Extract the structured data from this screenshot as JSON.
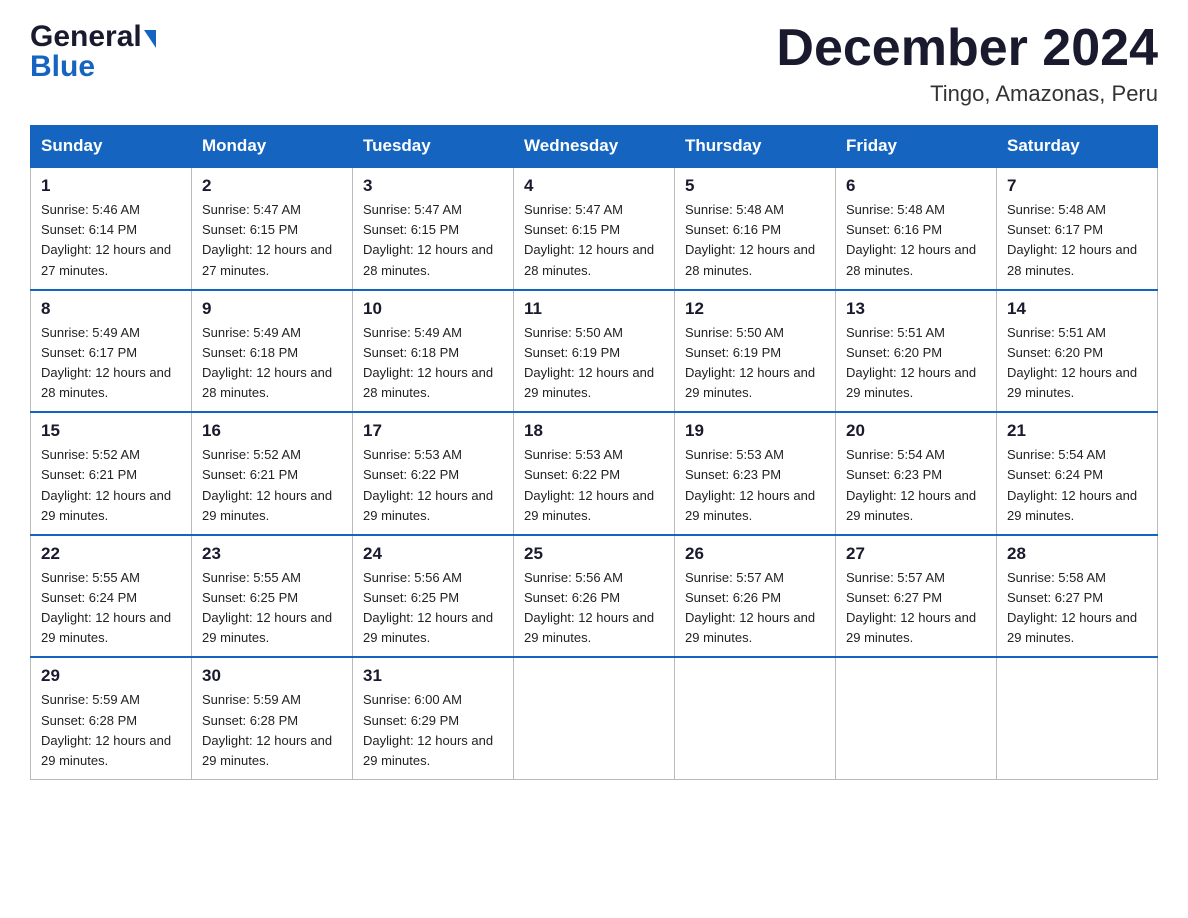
{
  "header": {
    "logo_general": "General",
    "logo_blue": "Blue",
    "month_title": "December 2024",
    "location": "Tingo, Amazonas, Peru"
  },
  "calendar": {
    "days_of_week": [
      "Sunday",
      "Monday",
      "Tuesday",
      "Wednesday",
      "Thursday",
      "Friday",
      "Saturday"
    ],
    "weeks": [
      [
        {
          "day": "1",
          "sunrise": "5:46 AM",
          "sunset": "6:14 PM",
          "daylight": "12 hours and 27 minutes."
        },
        {
          "day": "2",
          "sunrise": "5:47 AM",
          "sunset": "6:15 PM",
          "daylight": "12 hours and 27 minutes."
        },
        {
          "day": "3",
          "sunrise": "5:47 AM",
          "sunset": "6:15 PM",
          "daylight": "12 hours and 28 minutes."
        },
        {
          "day": "4",
          "sunrise": "5:47 AM",
          "sunset": "6:15 PM",
          "daylight": "12 hours and 28 minutes."
        },
        {
          "day": "5",
          "sunrise": "5:48 AM",
          "sunset": "6:16 PM",
          "daylight": "12 hours and 28 minutes."
        },
        {
          "day": "6",
          "sunrise": "5:48 AM",
          "sunset": "6:16 PM",
          "daylight": "12 hours and 28 minutes."
        },
        {
          "day": "7",
          "sunrise": "5:48 AM",
          "sunset": "6:17 PM",
          "daylight": "12 hours and 28 minutes."
        }
      ],
      [
        {
          "day": "8",
          "sunrise": "5:49 AM",
          "sunset": "6:17 PM",
          "daylight": "12 hours and 28 minutes."
        },
        {
          "day": "9",
          "sunrise": "5:49 AM",
          "sunset": "6:18 PM",
          "daylight": "12 hours and 28 minutes."
        },
        {
          "day": "10",
          "sunrise": "5:49 AM",
          "sunset": "6:18 PM",
          "daylight": "12 hours and 28 minutes."
        },
        {
          "day": "11",
          "sunrise": "5:50 AM",
          "sunset": "6:19 PM",
          "daylight": "12 hours and 29 minutes."
        },
        {
          "day": "12",
          "sunrise": "5:50 AM",
          "sunset": "6:19 PM",
          "daylight": "12 hours and 29 minutes."
        },
        {
          "day": "13",
          "sunrise": "5:51 AM",
          "sunset": "6:20 PM",
          "daylight": "12 hours and 29 minutes."
        },
        {
          "day": "14",
          "sunrise": "5:51 AM",
          "sunset": "6:20 PM",
          "daylight": "12 hours and 29 minutes."
        }
      ],
      [
        {
          "day": "15",
          "sunrise": "5:52 AM",
          "sunset": "6:21 PM",
          "daylight": "12 hours and 29 minutes."
        },
        {
          "day": "16",
          "sunrise": "5:52 AM",
          "sunset": "6:21 PM",
          "daylight": "12 hours and 29 minutes."
        },
        {
          "day": "17",
          "sunrise": "5:53 AM",
          "sunset": "6:22 PM",
          "daylight": "12 hours and 29 minutes."
        },
        {
          "day": "18",
          "sunrise": "5:53 AM",
          "sunset": "6:22 PM",
          "daylight": "12 hours and 29 minutes."
        },
        {
          "day": "19",
          "sunrise": "5:53 AM",
          "sunset": "6:23 PM",
          "daylight": "12 hours and 29 minutes."
        },
        {
          "day": "20",
          "sunrise": "5:54 AM",
          "sunset": "6:23 PM",
          "daylight": "12 hours and 29 minutes."
        },
        {
          "day": "21",
          "sunrise": "5:54 AM",
          "sunset": "6:24 PM",
          "daylight": "12 hours and 29 minutes."
        }
      ],
      [
        {
          "day": "22",
          "sunrise": "5:55 AM",
          "sunset": "6:24 PM",
          "daylight": "12 hours and 29 minutes."
        },
        {
          "day": "23",
          "sunrise": "5:55 AM",
          "sunset": "6:25 PM",
          "daylight": "12 hours and 29 minutes."
        },
        {
          "day": "24",
          "sunrise": "5:56 AM",
          "sunset": "6:25 PM",
          "daylight": "12 hours and 29 minutes."
        },
        {
          "day": "25",
          "sunrise": "5:56 AM",
          "sunset": "6:26 PM",
          "daylight": "12 hours and 29 minutes."
        },
        {
          "day": "26",
          "sunrise": "5:57 AM",
          "sunset": "6:26 PM",
          "daylight": "12 hours and 29 minutes."
        },
        {
          "day": "27",
          "sunrise": "5:57 AM",
          "sunset": "6:27 PM",
          "daylight": "12 hours and 29 minutes."
        },
        {
          "day": "28",
          "sunrise": "5:58 AM",
          "sunset": "6:27 PM",
          "daylight": "12 hours and 29 minutes."
        }
      ],
      [
        {
          "day": "29",
          "sunrise": "5:59 AM",
          "sunset": "6:28 PM",
          "daylight": "12 hours and 29 minutes."
        },
        {
          "day": "30",
          "sunrise": "5:59 AM",
          "sunset": "6:28 PM",
          "daylight": "12 hours and 29 minutes."
        },
        {
          "day": "31",
          "sunrise": "6:00 AM",
          "sunset": "6:29 PM",
          "daylight": "12 hours and 29 minutes."
        },
        null,
        null,
        null,
        null
      ]
    ]
  }
}
